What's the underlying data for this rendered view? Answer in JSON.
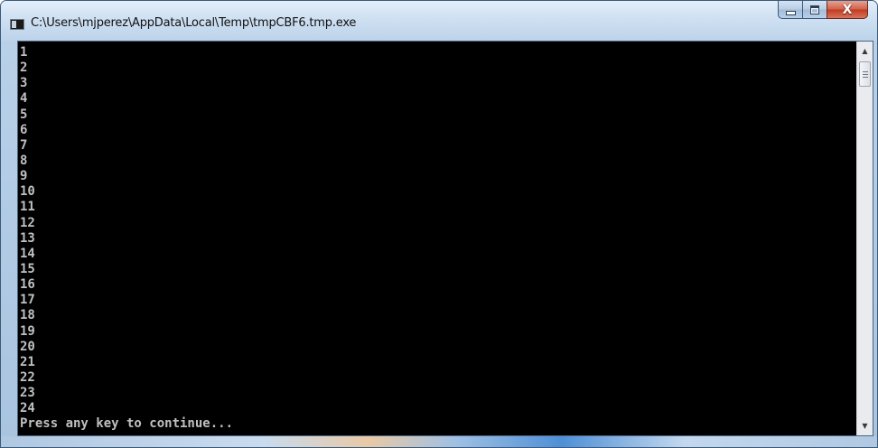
{
  "window": {
    "title": "C:\\Users\\mjperez\\AppData\\Local\\Temp\\tmpCBF6.tmp.exe",
    "icon": "console-app-icon",
    "controls": {
      "minimize": "minimize-icon",
      "maximize": "maximize-icon",
      "close_label": "X"
    }
  },
  "console": {
    "lines": [
      "1",
      "2",
      "3",
      "4",
      "5",
      "6",
      "7",
      "8",
      "9",
      "10",
      "11",
      "12",
      "13",
      "14",
      "15",
      "16",
      "17",
      "18",
      "19",
      "20",
      "21",
      "22",
      "23",
      "24",
      "Press any key to continue..."
    ]
  },
  "scrollbar": {
    "up_arrow": "▲",
    "down_arrow": "▼"
  },
  "colors": {
    "console_bg": "#000000",
    "console_text": "#c0c0c0",
    "close_button": "#c0391f"
  }
}
